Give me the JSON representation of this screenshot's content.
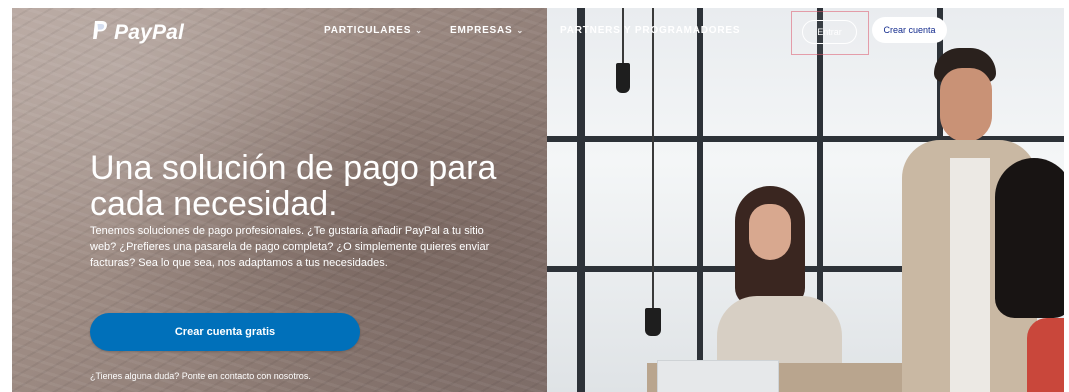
{
  "brand": {
    "name": "PayPal"
  },
  "nav": {
    "items": [
      {
        "label": "PARTICULARES",
        "has_dropdown": true
      },
      {
        "label": "EMPRESAS",
        "has_dropdown": true
      },
      {
        "label": "PARTNERS Y PROGRAMADORES",
        "has_dropdown": false
      }
    ],
    "login_label": "Entrar",
    "signup_label": "Crear cuenta"
  },
  "hero": {
    "title_line1": "Una solución de pago para",
    "title_line2": "cada necesidad.",
    "description": "Tenemos soluciones de pago profesionales. ¿Te gustaría añadir PayPal a tu sitio web? ¿Prefieres una pasarela de pago completa? ¿O simplemente quieres enviar facturas? Sea lo que sea, nos adaptamos a tus necesidades.",
    "cta_label": "Crear cuenta gratis",
    "help_text": "¿Tienes alguna duda? Ponte en contacto con nosotros."
  },
  "colors": {
    "primary_blue": "#0070ba",
    "brand_navy": "#142c8e",
    "text_on_image": "#ffffff"
  },
  "icons": {
    "logo": "paypal-logo-icon",
    "dropdown": "chevron-down-icon"
  }
}
